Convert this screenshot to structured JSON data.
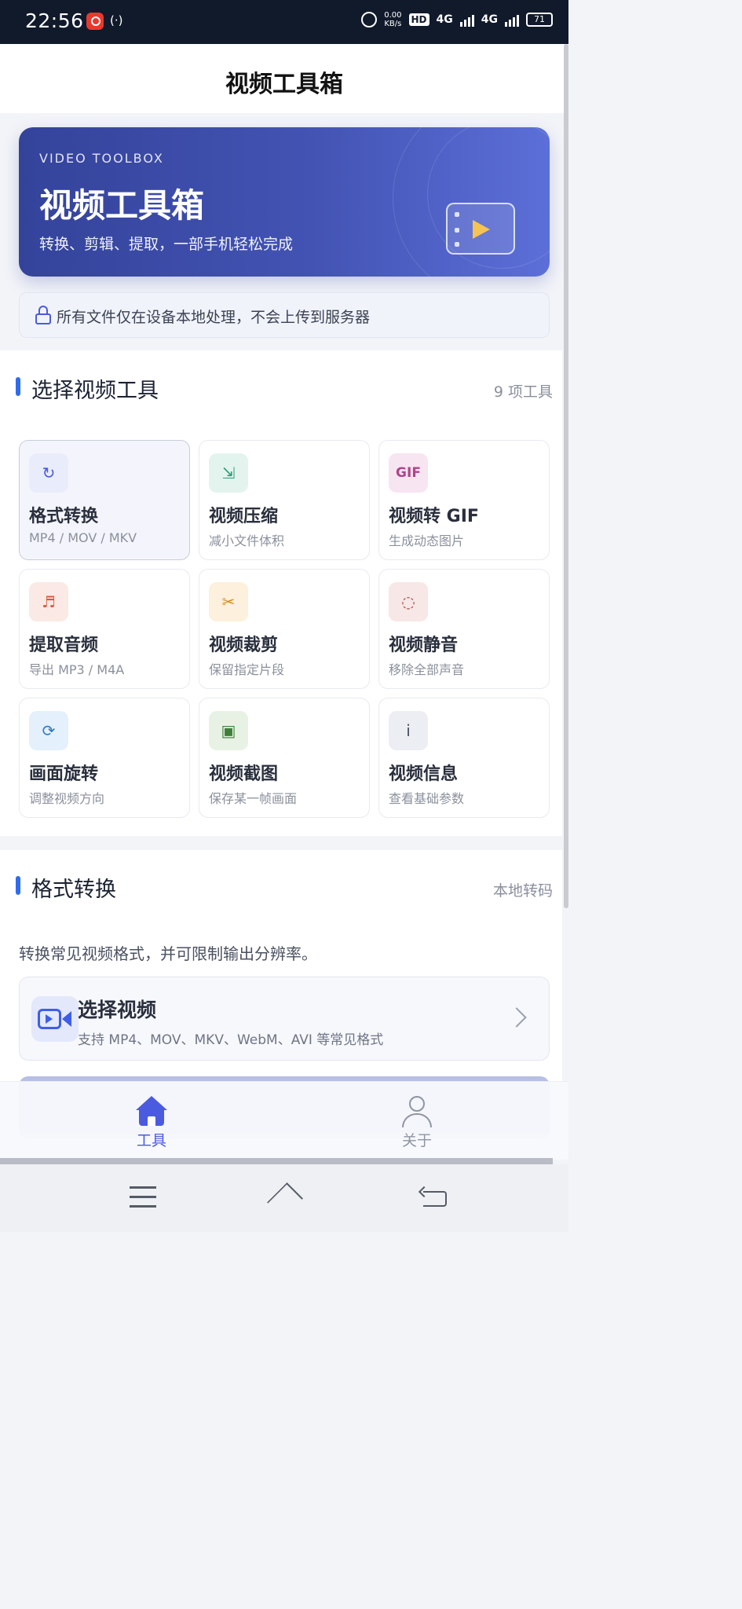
{
  "status_bar": {
    "time": "22:56",
    "hotspot_glyph": "(·)",
    "speed_value": "0.00",
    "speed_unit": "KB/s",
    "hd_label": "HD",
    "network_1": "4G",
    "network_2": "4G",
    "battery": "71"
  },
  "topbar": {
    "title": "视频工具箱"
  },
  "hero": {
    "eyebrow": "VIDEO TOOLBOX",
    "title": "视频工具箱",
    "subtitle": "转换、剪辑、提取，一部手机轻松完成"
  },
  "notice": {
    "text": "所有文件仅在设备本地处理，不会上传到服务器"
  },
  "tools_section": {
    "title": "选择视频工具",
    "count": "9 项工具",
    "tools": [
      {
        "title": "格式转换",
        "subtitle": "MP4 / MOV / MKV",
        "icon": "refresh-icon",
        "glyph": "↻",
        "icon_bg": "#e9ecfb",
        "icon_color": "#4a5be0"
      },
      {
        "title": "视频压缩",
        "subtitle": "减小文件体积",
        "icon": "compress-icon",
        "glyph": "⇲",
        "icon_bg": "#e3f4ee",
        "icon_color": "#2f9a78"
      },
      {
        "title": "视频转 GIF",
        "subtitle": "生成动态图片",
        "icon": "gif-icon",
        "glyph": "GIF",
        "icon_bg": "#f7e5f1",
        "icon_color": "#b0448a"
      },
      {
        "title": "提取音频",
        "subtitle": "导出 MP3 / M4A",
        "icon": "music-icon",
        "glyph": "♬",
        "icon_bg": "#fbe9e5",
        "icon_color": "#d85a3f"
      },
      {
        "title": "视频裁剪",
        "subtitle": "保留指定片段",
        "icon": "scissors-icon",
        "glyph": "✂",
        "icon_bg": "#fdf0dc",
        "icon_color": "#d98a1e"
      },
      {
        "title": "视频静音",
        "subtitle": "移除全部声音",
        "icon": "mute-icon",
        "glyph": "◌",
        "icon_bg": "#f7e7e7",
        "icon_color": "#b0443c"
      },
      {
        "title": "画面旋转",
        "subtitle": "调整视频方向",
        "icon": "rotate-icon",
        "glyph": "⟳",
        "icon_bg": "#e4f0fb",
        "icon_color": "#2f7bc4"
      },
      {
        "title": "视频截图",
        "subtitle": "保存某一帧画面",
        "icon": "screenshot-icon",
        "glyph": "▣",
        "icon_bg": "#e7f2e4",
        "icon_color": "#3f7f3a"
      },
      {
        "title": "视频信息",
        "subtitle": "查看基础参数",
        "icon": "info-icon",
        "glyph": "i",
        "icon_bg": "#eceef3",
        "icon_color": "#4a5060"
      }
    ]
  },
  "format_section": {
    "title": "格式转换",
    "meta": "本地转码",
    "description": "转换常见视频格式，并可限制输出分辨率。",
    "select_title": "选择视频",
    "select_subtitle": "支持 MP4、MOV、MKV、WebM、AVI 等常见格式"
  },
  "bottom_nav": {
    "items": [
      {
        "label": "工具",
        "active": true
      },
      {
        "label": "关于",
        "active": false
      }
    ]
  },
  "colors": {
    "accent": "#4a5be0",
    "section_bar": "#2f6bf0",
    "hero_start": "#34439a",
    "hero_end": "#5c6fd8"
  }
}
